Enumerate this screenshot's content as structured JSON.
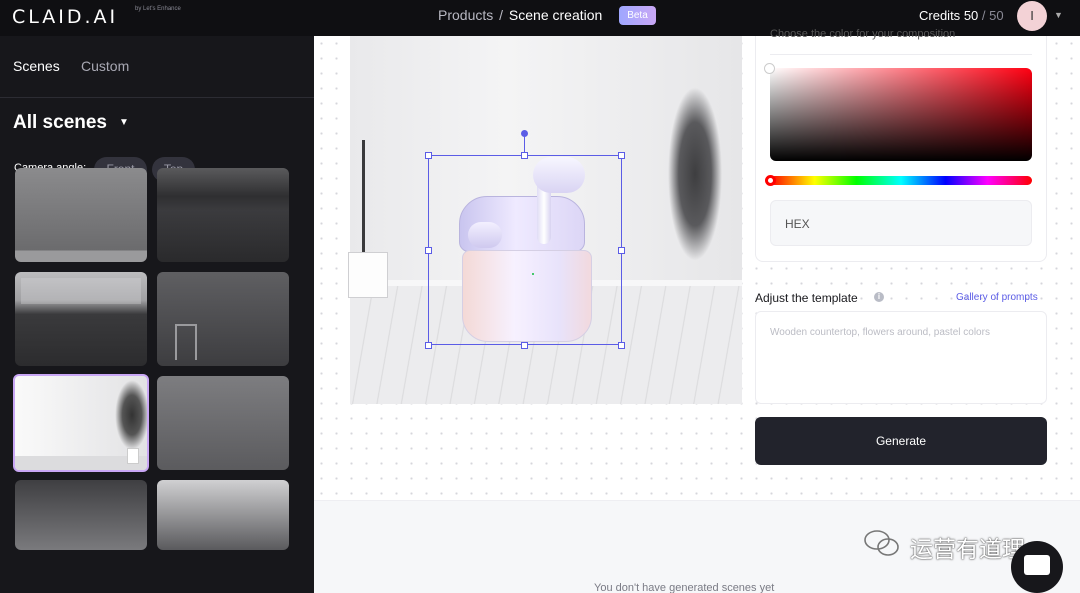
{
  "header": {
    "logo": "CLAID.AI",
    "logo_sub": "by Let's Enhance",
    "breadcrumb_parent": "Products",
    "breadcrumb_sep": "/",
    "breadcrumb_current": "Scene creation",
    "badge": "Beta",
    "credits_label": "Credits",
    "credits_used": "50",
    "credits_sep": "/",
    "credits_total": "50",
    "avatar_initial": "I"
  },
  "sidebar": {
    "tabs": [
      {
        "label": "Scenes"
      },
      {
        "label": "Custom"
      }
    ],
    "section_title": "All scenes",
    "camera_label": "Camera angle:",
    "camera_options": [
      {
        "label": "Front"
      },
      {
        "label": "Top"
      }
    ]
  },
  "color_picker": {
    "hint": "Choose the color for your composition",
    "hex_label": "HEX"
  },
  "template": {
    "label": "Adjust the template",
    "gallery_link": "Gallery of prompts",
    "placeholder": "Wooden countertop, flowers around, pastel colors"
  },
  "actions": {
    "generate": "Generate"
  },
  "empty_state": "You don't have generated scenes yet",
  "watermark": "运营有道理",
  "colors": {
    "accent": "#5b5ce6",
    "sidebar_bg": "#17171b",
    "generate_bg": "#22232c"
  }
}
